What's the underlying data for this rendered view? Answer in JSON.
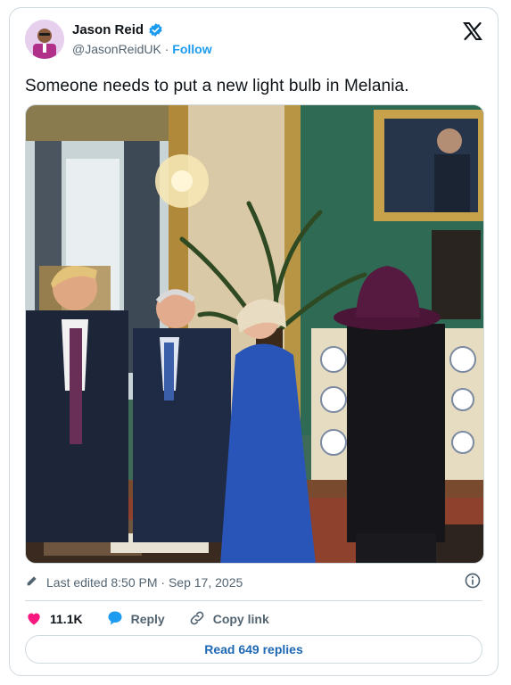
{
  "author": {
    "display_name": "Jason Reid",
    "handle": "@JasonReidUK",
    "separator": " · ",
    "follow_label": "Follow",
    "verified_icon": "verified-badge-icon"
  },
  "brand_icon": "x-logo-icon",
  "tweet": {
    "text": "Someone needs to put a new light bulb in Melania."
  },
  "meta": {
    "edited_text": "Last edited 8:50 PM · Sep 17, 2025",
    "edit_icon": "pencil-icon",
    "info_icon": "info-icon"
  },
  "actions": {
    "likes": "11.1K",
    "reply_label": "Reply",
    "copy_link_label": "Copy link"
  },
  "read_replies_label": "Read 649 replies",
  "colors": {
    "accent": "#1d9bf0",
    "like": "#f91880",
    "text_secondary": "#536471",
    "border": "#cfd9de"
  }
}
